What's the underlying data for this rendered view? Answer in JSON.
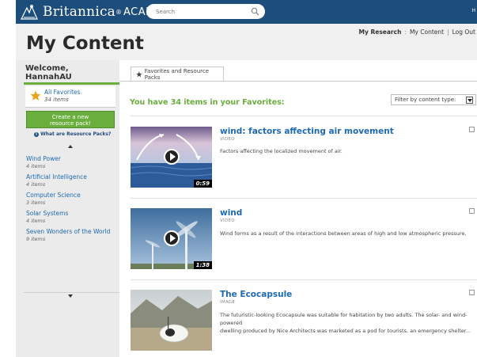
{
  "header": {
    "brand": "Britannica",
    "brand_suffix": "ACADEMIC",
    "search_placeholder": "Search",
    "right_edge_char": "H",
    "nav_my_research": "My Research",
    "nav_sep_1": ":",
    "nav_my_content": "My Content",
    "nav_sep_2": "|",
    "nav_log_out": "Log Out"
  },
  "page": {
    "title": "My Content"
  },
  "sidebar": {
    "welcome_line1": "Welcome,",
    "welcome_line2": "HannahAU",
    "all_favorites_label": "All Favorites",
    "all_favorites_count": "34 items",
    "create_button_line1": "Create a new",
    "create_button_line2": "resource pack!",
    "what_are_label": "What are Resource Packs?",
    "packs": [
      {
        "name": "Wind Power",
        "count": "4 items"
      },
      {
        "name": "Artificial Intelligence",
        "count": "4 items"
      },
      {
        "name": "Computer Science",
        "count": "3 items"
      },
      {
        "name": "Solar Systems",
        "count": "4 items"
      },
      {
        "name": "Seven Wonders of the World",
        "count": "9 items"
      }
    ]
  },
  "main": {
    "tab_label": "Favorites and Resource Packs",
    "count_text": "You have 34 items in your Favorites:",
    "filter_label": "Filter by content type:",
    "items": [
      {
        "title": "wind: factors affecting air movement",
        "type": "VIDEO",
        "description": "Factors affecting the localized movement of air.",
        "duration": "0:59"
      },
      {
        "title": "wind",
        "type": "VIDEO",
        "description": "Wind forms as a result of the interactions between areas of high and low atmospheric pressure.",
        "duration": "1:38"
      },
      {
        "title": "The Ecocapsule",
        "type": "IMAGE",
        "description_line1": "The futuristic-looking Ecocapsule was suitable for habitation by two adults. The solar- and wind-powered",
        "description_line2": "dwelling produced by Nice Architects was marketed as a pod for tourists, an emergency shelter..."
      }
    ]
  },
  "colors": {
    "header_bg": "#1d4d7a",
    "accent_green": "#6aae3d",
    "link_blue": "#1d6ab0",
    "favorite_star": "#e8a317"
  }
}
